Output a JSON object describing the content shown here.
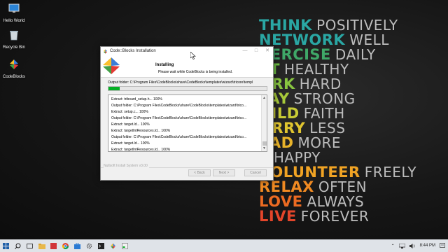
{
  "desktop": {
    "icons": [
      {
        "label": "Hello World",
        "icon": "monitor-icon"
      },
      {
        "label": "Recycle Bin",
        "icon": "recycle-bin-icon"
      },
      {
        "label": "CodeBlocks",
        "icon": "codeblocks-icon"
      }
    ],
    "wallpaper": [
      {
        "bold": "THINK",
        "bold_color": "#2aa7a4",
        "thin": "POSITIVELY"
      },
      {
        "bold": "NETWORK",
        "bold_color": "#2aa7a4",
        "thin": "WELL"
      },
      {
        "bold": "XERCISE",
        "bold_color": "#3fa868",
        "thin": "DAILY"
      },
      {
        "bold": "AT",
        "bold_color": "#6fbf46",
        "thin": "HEALTHY"
      },
      {
        "bold": "ORK",
        "bold_color": "#88c540",
        "thin": "HARD"
      },
      {
        "bold": "TAY",
        "bold_color": "#a7c93a",
        "thin": "STRONG"
      },
      {
        "bold": "UILD",
        "bold_color": "#c8cc35",
        "thin": "FAITH"
      },
      {
        "bold": "ORRY",
        "bold_color": "#e0c52f",
        "thin": "LESS"
      },
      {
        "bold": "EAD",
        "bold_color": "#e8b32a",
        "thin": "MORE"
      },
      {
        "bold": "E",
        "bold_color": "#eeaa28",
        "thin": "HAPPY"
      },
      {
        "bold": "VOLUNTEER",
        "bold_color": "#f0a324",
        "thin": "FREELY"
      },
      {
        "bold": "RELAX",
        "bold_color": "#f08a22",
        "thin": "OFTEN"
      },
      {
        "bold": "LOVE",
        "bold_color": "#ec6b22",
        "thin": "ALWAYS"
      },
      {
        "bold": "LIVE",
        "bold_color": "#e3452a",
        "thin": "FOREVER"
      }
    ]
  },
  "installer": {
    "title": "Code::Blocks Installation",
    "header_title": "Installing",
    "header_subtitle": "Please wait while CodeBlocks is being installed.",
    "output_folder": "Output folder: C:\\Program Files\\CodeBlocks\\share\\CodeBlocks\\templates\\wizard\\tricore\\templ",
    "progress": 0.07,
    "log": [
      "Extract: triboard_setup.h... 100%",
      "Output folder: C:\\Program Files\\CodeBlocks\\share\\CodeBlocks\\templates\\wizard\\trico...",
      "Extract: setup.c... 100%",
      "Output folder: C:\\Program Files\\CodeBlocks\\share\\CodeBlocks\\templates\\wizard\\trico...",
      "Extract: target.ld... 100%",
      "Extract: targetIntResources.ld... 100%",
      "Output folder: C:\\Program Files\\CodeBlocks\\share\\CodeBlocks\\templates\\wizard\\trico...",
      "Extract: target.ld... 100%",
      "Extract: targetIntResources.ld... 100%"
    ],
    "brand": "Nullsoft Install System v3.00",
    "back_label": "< Back",
    "next_label": "Next >",
    "cancel_label": "Cancel"
  },
  "taskbar": {
    "clock": "8:44 PM",
    "apps": [
      "start-icon",
      "search-icon",
      "task-view-icon",
      "file-explorer-icon",
      "firefox-icon",
      "chrome-icon",
      "store-icon",
      "settings-icon",
      "terminal-icon",
      "codeblocks-icon",
      "installer-icon"
    ],
    "colors": {
      "accent": "#06b025"
    }
  }
}
